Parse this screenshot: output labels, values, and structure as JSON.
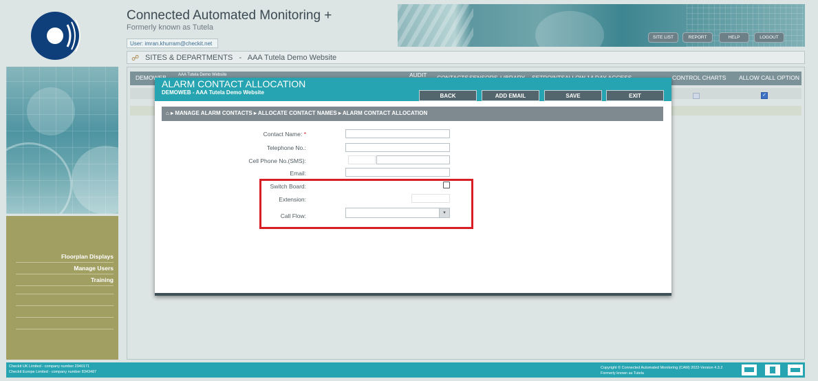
{
  "header": {
    "title": "Connected Automated Monitoring +",
    "subtitle": "Formerly known as Tutela",
    "user_label": "User: imran.khurram@checkit.net",
    "top_buttons": [
      "SITE LIST",
      "REPORT",
      "HELP",
      "LOGOUT"
    ]
  },
  "breadcrumb": {
    "section": "SITES & DEPARTMENTS",
    "separator": "-",
    "site": "AAA Tutela Demo Website"
  },
  "sidebar": {
    "items": [
      "Floorplan Displays",
      "Manage Users",
      "Training"
    ]
  },
  "table": {
    "headers": [
      "DEMOWEB",
      "AAA Tutela Demo Website",
      "AUDIT",
      "CONTACTS",
      "SENSORS",
      "LIBRARY",
      "SETPOINTS",
      "ALLOW 14 DAY ACCESS",
      "CONTROL CHARTS",
      "ALLOW CALL OPTION"
    ],
    "row1": {
      "control_charts": false,
      "allow_call_option": true
    }
  },
  "dialog": {
    "title": "ALARM CONTACT ALLOCATION",
    "subtitle": "DEMOWEB - AAA Tutela Demo Website",
    "buttons": {
      "back": "BACK",
      "add_email": "ADD EMAIL",
      "save": "SAVE",
      "exit": "EXIT"
    },
    "crumbs": "MANAGE ALARM CONTACTS ▸ ALLOCATE CONTACT NAMES ▸ ALARM CONTACT ALLOCATION",
    "form": {
      "contact_name_label": "Contact Name:",
      "required_mark": "*",
      "telephone_label": "Telephone No.:",
      "cell_phone_label": "Cell Phone No.(SMS):",
      "email_label": "Email:",
      "switch_board_label": "Switch Board:",
      "extension_label": "Extension:",
      "call_flow_label": "Call Flow:",
      "contact_name_value": "",
      "telephone_value": "",
      "cell_prefix_value": "",
      "cell_value": "",
      "email_value": "",
      "extension_value": "",
      "call_flow_value": "",
      "switch_board_checked": false
    }
  },
  "footer": {
    "left_line1": "Checkit UK Limited - company number 2940171",
    "left_line2": "Checkit Europe Limited - company number 8343487",
    "right_line1": "Copyright © Connected Automated Monitoring (CAM) 2022-Version 4.3.2",
    "right_line2": "Formerly known as Tutela"
  },
  "colors": {
    "accent": "#26a4b1",
    "sidebar_nav": "#a19f62",
    "highlight": "#d81d25"
  }
}
